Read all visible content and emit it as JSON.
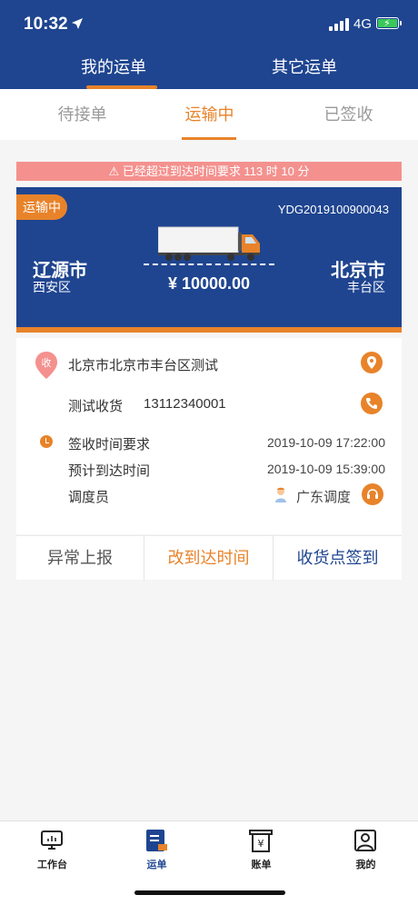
{
  "status_bar": {
    "time": "10:32",
    "network": "4G"
  },
  "header": {
    "tabs": [
      {
        "label": "我的运单",
        "active": true
      },
      {
        "label": "其它运单",
        "active": false
      }
    ]
  },
  "subtabs": [
    {
      "label": "待接单",
      "active": false
    },
    {
      "label": "运输中",
      "active": true
    },
    {
      "label": "已签收",
      "active": false
    }
  ],
  "warning": {
    "text": "⚠ 已经超过到达时间要求 113 时 10 分"
  },
  "order": {
    "status_badge": "运输中",
    "order_no": "YDG2019100900043",
    "from_city": "辽源市",
    "from_district": "西安区",
    "to_city": "北京市",
    "to_district": "丰台区",
    "price": "¥ 10000.00",
    "pin_label": "收",
    "address": "北京市北京市丰台区测试",
    "contact_name": "测试收货",
    "contact_phone": "13112340001",
    "sign_time_label": "签收时间要求",
    "sign_time_value": "2019-10-09 17:22:00",
    "eta_label": "预计到达时间",
    "eta_value": "2019-10-09 15:39:00",
    "dispatcher_label": "调度员",
    "dispatcher_name": "广东调度"
  },
  "actions": [
    {
      "label": "异常上报",
      "color": "#555555"
    },
    {
      "label": "改到达时间",
      "color": "#e8832a"
    },
    {
      "label": "收货点签到",
      "color": "#1f4590"
    }
  ],
  "bottom_nav": [
    {
      "label": "工作台",
      "icon": "monitor-icon",
      "active": false
    },
    {
      "label": "运单",
      "icon": "waybill-icon",
      "active": true
    },
    {
      "label": "账单",
      "icon": "bill-icon",
      "active": false
    },
    {
      "label": "我的",
      "icon": "profile-icon",
      "active": false
    }
  ],
  "colors": {
    "primary": "#1f4590",
    "accent": "#e8832a",
    "warning": "#f4918e"
  }
}
